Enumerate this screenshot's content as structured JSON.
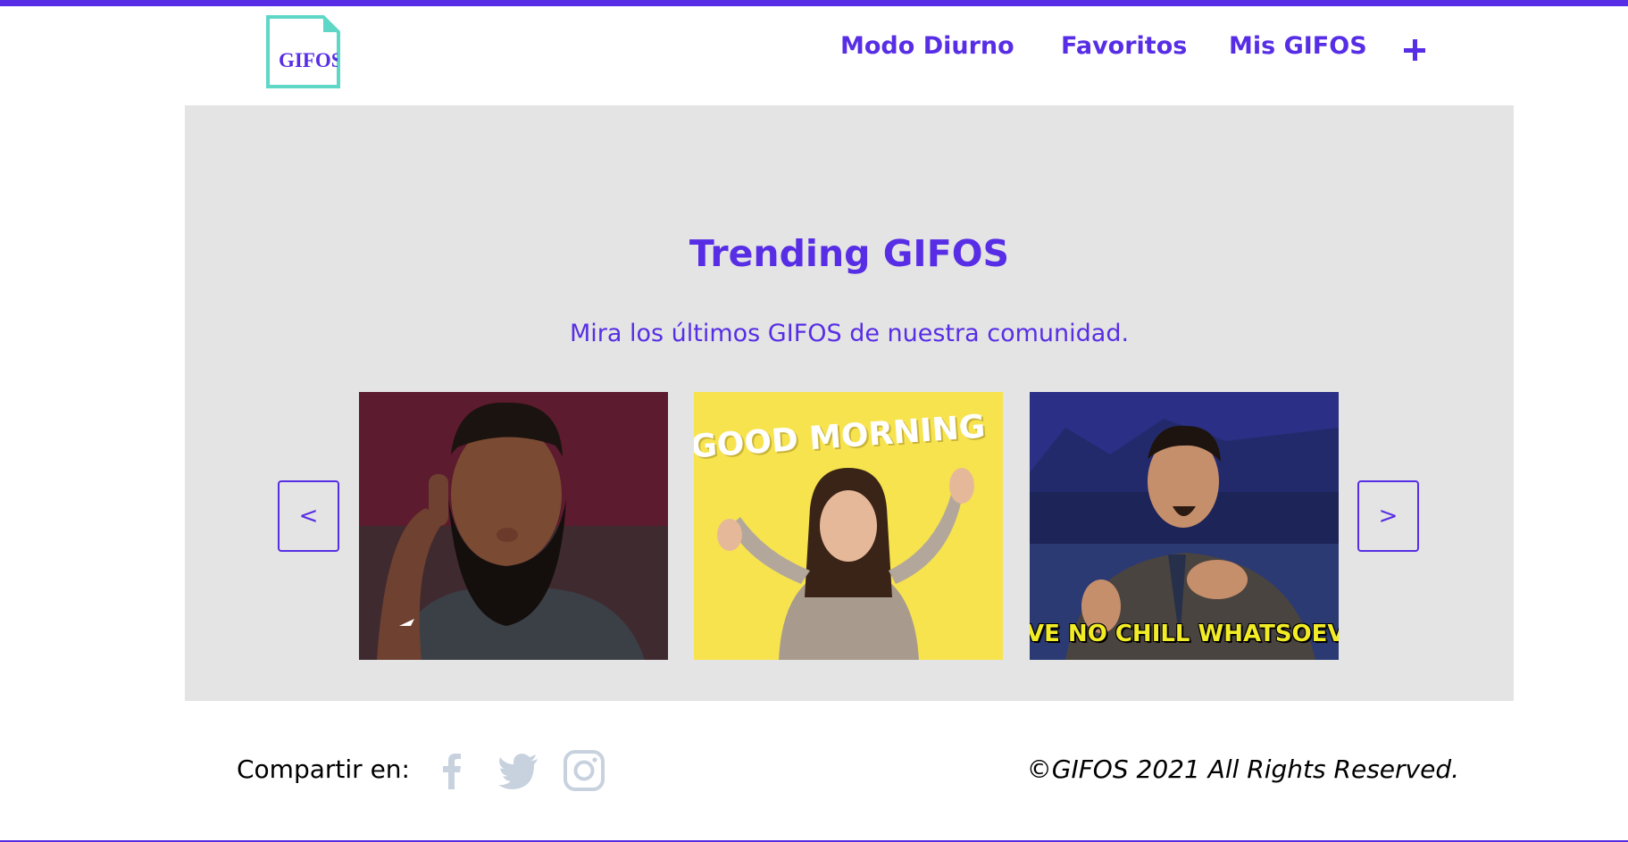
{
  "header": {
    "logo_text": "GIFOS",
    "nav": {
      "modo": "Modo Diurno",
      "favoritos": "Favoritos",
      "mis_gifos": "Mis GIFOS"
    }
  },
  "trending": {
    "title": "Trending GIFOS",
    "subtitle": "Mira los últimos GIFOS de nuestra comunidad.",
    "prev_label": "<",
    "next_label": ">",
    "gifs": [
      {
        "caption": ""
      },
      {
        "caption": "GOOD MORNING"
      },
      {
        "caption": "VE NO CHILL WHATSOEV"
      }
    ]
  },
  "footer": {
    "share_label": "Compartir en:",
    "social_icons": [
      "facebook-icon",
      "twitter-icon",
      "instagram-icon"
    ],
    "copyright": "©GIFOS 2021 All Rights Reserved."
  },
  "colors": {
    "accent": "#572ee5",
    "logo_teal": "#5ed7c6",
    "trending_bg": "#e4e4e4",
    "social_gray": "#c8d2de"
  }
}
